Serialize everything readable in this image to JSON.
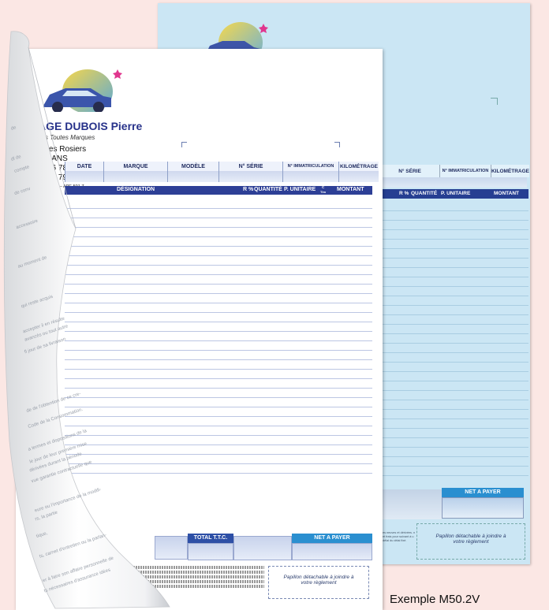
{
  "company": {
    "name": "AGE DUBOIS Pierre",
    "tagline": "ons Toutes Marques",
    "address_lines": [
      "e des Rosiers",
      "F MANS",
      "56 78",
      "56 79"
    ],
    "registration": "0012 – APE 501 Z"
  },
  "table": {
    "columns": [
      "DATE",
      "MARQUE",
      "MODÈLE",
      "N° SÉRIE",
      "N° IMMATRICULATION",
      "KILOMÉTRAGE"
    ],
    "designation": "DÉSIGNATION",
    "rem": "R %",
    "quantite": "QUANTITÉ",
    "prix_unitaire": "P. UNITAIRE",
    "centimes_top": "C",
    "centimes_bottom": "Tim",
    "montant": "MONTANT"
  },
  "totals": {
    "total_ttc": "TOTAL T.T.C.",
    "net_a_payer": "NET A PAYER"
  },
  "papillon": {
    "text_line1": "Papillon détachable à joindre à",
    "text_line2": "votre règlement"
  },
  "back_sheet": {
    "columns": [
      "N° SÉRIE",
      "N° IMMATRICULATION",
      "KILOMÉTRAGE"
    ],
    "rem": "R %",
    "quantite": "QUANTITÉ",
    "prix_unitaire": "P. UNITAIRE",
    "montant": "MONTANT",
    "net_a_payer": "NET A PAYER",
    "papillon_line1": "Papillon détachable à joindre à",
    "papillon_line2": "votre règlement",
    "small_note": "es neuves et dérivées. n et frais pour suivant à u délai du délai fixé."
  },
  "peel_fragments": [
    "de",
    "dl de",
    "compte",
    "de conv",
    "accessoire",
    "au moment de",
    "qui reste acquis",
    "accepter il en résulte",
    "avancés ou tout autre",
    "fl jour de sa livraison",
    "de de l'obtention de ce cre-",
    "Code de la Consommation.",
    "a termes et dispositions de la",
    "le jour de leur première mise",
    "dérivées durant la période",
    "vue garantie contractuelle que",
    "eure ou l'importance de la modifi-",
    "rs, la partie",
    "tique,",
    "ts, carnet d'entretien ou la parlan-",
    "er à faire son affaire personnelle de",
    "ts nécessaires d'assurance idées"
  ],
  "example_label": "Exemple M50.2V",
  "colors": {
    "navy": "#2d3f96",
    "blue": "#2a8fd0",
    "back_sheet": "#cbe6f4",
    "background": "#fbe7e4"
  }
}
